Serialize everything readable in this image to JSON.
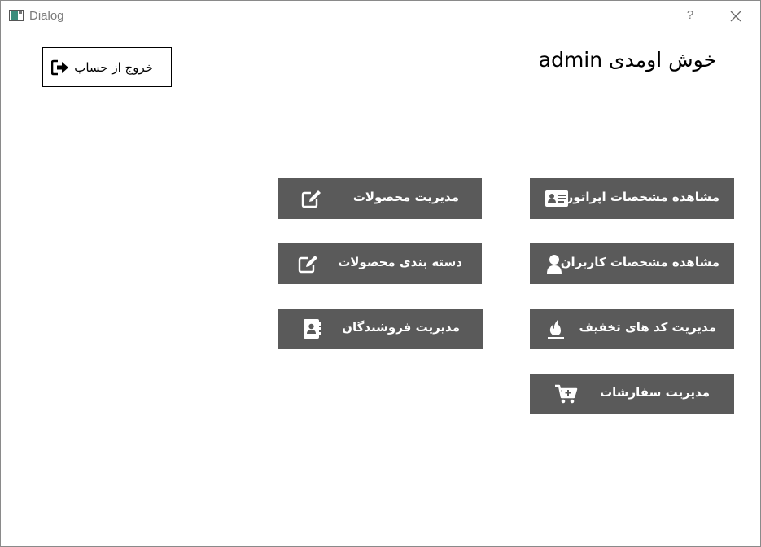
{
  "window": {
    "title": "Dialog",
    "help_glyph": "?"
  },
  "header": {
    "logout_label": "خروج از حساب",
    "welcome_text": "خوش اومدی admin"
  },
  "buttons": {
    "manage_products": "مدیریت محصولات",
    "view_operator_details": "مشاهده مشخصات اپراتور",
    "product_categories": "دسته بندی محصولات",
    "view_user_details": "مشاهده مشخصات کاربران",
    "manage_sellers": "مدیریت فروشندگان",
    "manage_discount_codes": "مدیریت کد های تخفیف",
    "manage_orders": "مدیریت سفارشات"
  },
  "colors": {
    "button_bg": "#5a5a5a",
    "button_text": "#ffffff"
  },
  "icons": {
    "logout": "sign-out-icon",
    "manage_products": "edit-icon",
    "view_operator_details": "id-card-icon",
    "product_categories": "edit-icon",
    "view_user_details": "user-icon",
    "manage_sellers": "address-book-icon",
    "manage_discount_codes": "fire-icon",
    "manage_orders": "cart-plus-icon"
  }
}
